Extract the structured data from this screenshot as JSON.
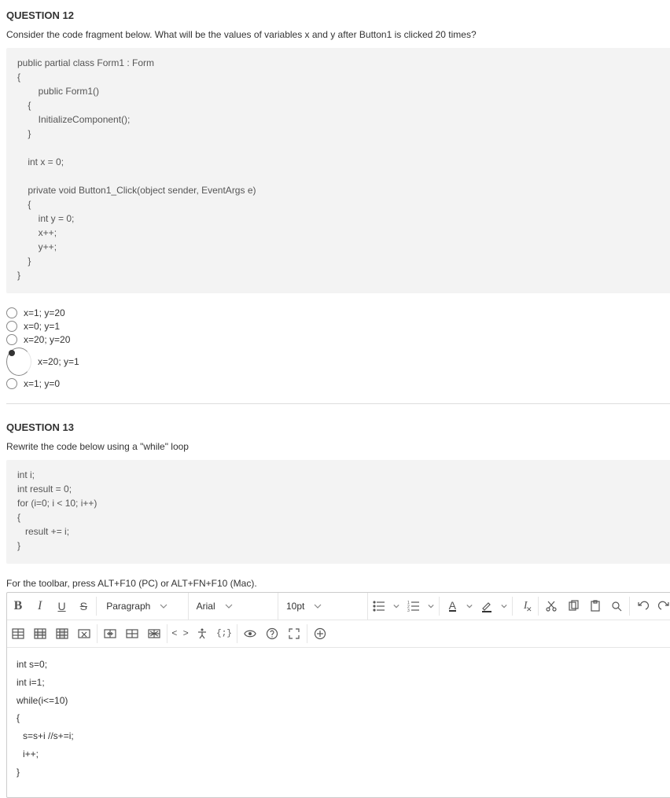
{
  "q12": {
    "title": "QUESTION 12",
    "prompt": "Consider the code fragment below. What will be the values of variables x and y after Button1 is clicked  20 times?",
    "code": "public partial class Form1 : Form\n{\n        public Form1()\n    {\n        InitializeComponent();\n    }\n\n    int x = 0;\n\n    private void Button1_Click(object sender, EventArgs e)\n    {\n        int y = 0;\n        x++;\n        y++;\n    }\n}",
    "choices": [
      {
        "label": "x=1; y=20",
        "selected": false
      },
      {
        "label": "x=0; y=1",
        "selected": false
      },
      {
        "label": "x=20; y=20",
        "selected": false
      },
      {
        "label": "x=20; y=1",
        "selected": true
      },
      {
        "label": "x=1; y=0",
        "selected": false
      }
    ]
  },
  "q13": {
    "title": "QUESTION 13",
    "prompt": "Rewrite the code below using a \"while\" loop",
    "code": "int i;\nint result = 0;\nfor (i=0; i < 10; i++)\n{\n   result += i;\n}",
    "toolbar_hint": "For the toolbar, press ALT+F10 (PC) or ALT+FN+F10 (Mac).",
    "toolbar": {
      "paragraph": "Paragraph",
      "font": "Arial",
      "size": "10pt",
      "fontcolor_letter": "A",
      "code_angle": "< >",
      "code_braces": "{;}"
    },
    "answer_lines": [
      "int s=0;",
      "int i=1;",
      "while(i<=10)",
      "{",
      "  s=s+i //s+=i;",
      "  i++;",
      "}"
    ]
  }
}
